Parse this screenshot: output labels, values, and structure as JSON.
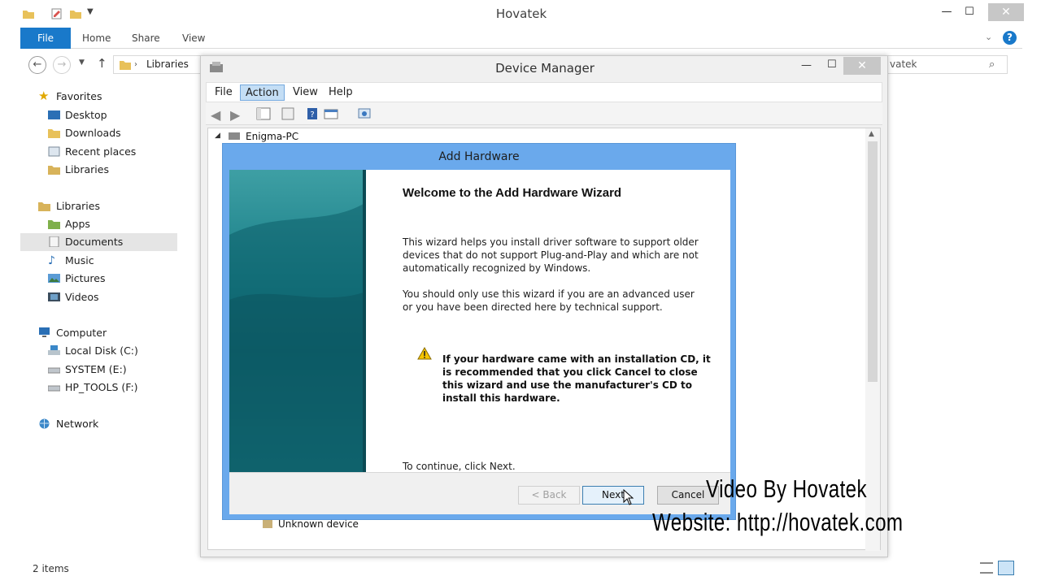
{
  "explorer": {
    "title": "Hovatek",
    "ribbon_tabs": [
      "File",
      "Home",
      "Share",
      "View"
    ],
    "address_path": "Libraries",
    "search_text": "vatek",
    "status_items": "2 items",
    "nav": {
      "favorites": [
        "Favorites",
        "Desktop",
        "Downloads",
        "Recent places",
        "Libraries"
      ],
      "libraries": [
        "Libraries",
        "Apps",
        "Documents",
        "Music",
        "Pictures",
        "Videos"
      ],
      "computer": [
        "Computer",
        "Local Disk (C:)",
        "SYSTEM (E:)",
        "HP_TOOLS (F:)"
      ],
      "network": "Network"
    }
  },
  "device_manager": {
    "title": "Device Manager",
    "menus": [
      "File",
      "Action",
      "View",
      "Help"
    ],
    "tree_root": "Enigma-PC",
    "tree_bottom_item": "Unknown device"
  },
  "wizard": {
    "title": "Add Hardware",
    "heading": "Welcome to the Add Hardware Wizard",
    "para1": "This wizard helps you install driver software to support older devices that do not support Plug-and-Play and which are not automatically recognized by Windows.",
    "para2": "You should only use this wizard if you are an advanced user or you have been directed here by technical support.",
    "warning": "If your hardware came with an installation CD, it is recommended that you click Cancel to close this wizard and use the manufacturer's CD to install this hardware.",
    "continue_text": "To continue, click Next.",
    "back_label": "< Back",
    "next_label": "Next",
    "cancel_label": "Cancel"
  },
  "watermark": {
    "line1": "Video By Hovatek",
    "line2": "Website: http://hovatek.com"
  },
  "colors": {
    "file_tab": "#1979ca",
    "wizard_frame": "#6aa9ec",
    "selection": "#c4def5"
  }
}
